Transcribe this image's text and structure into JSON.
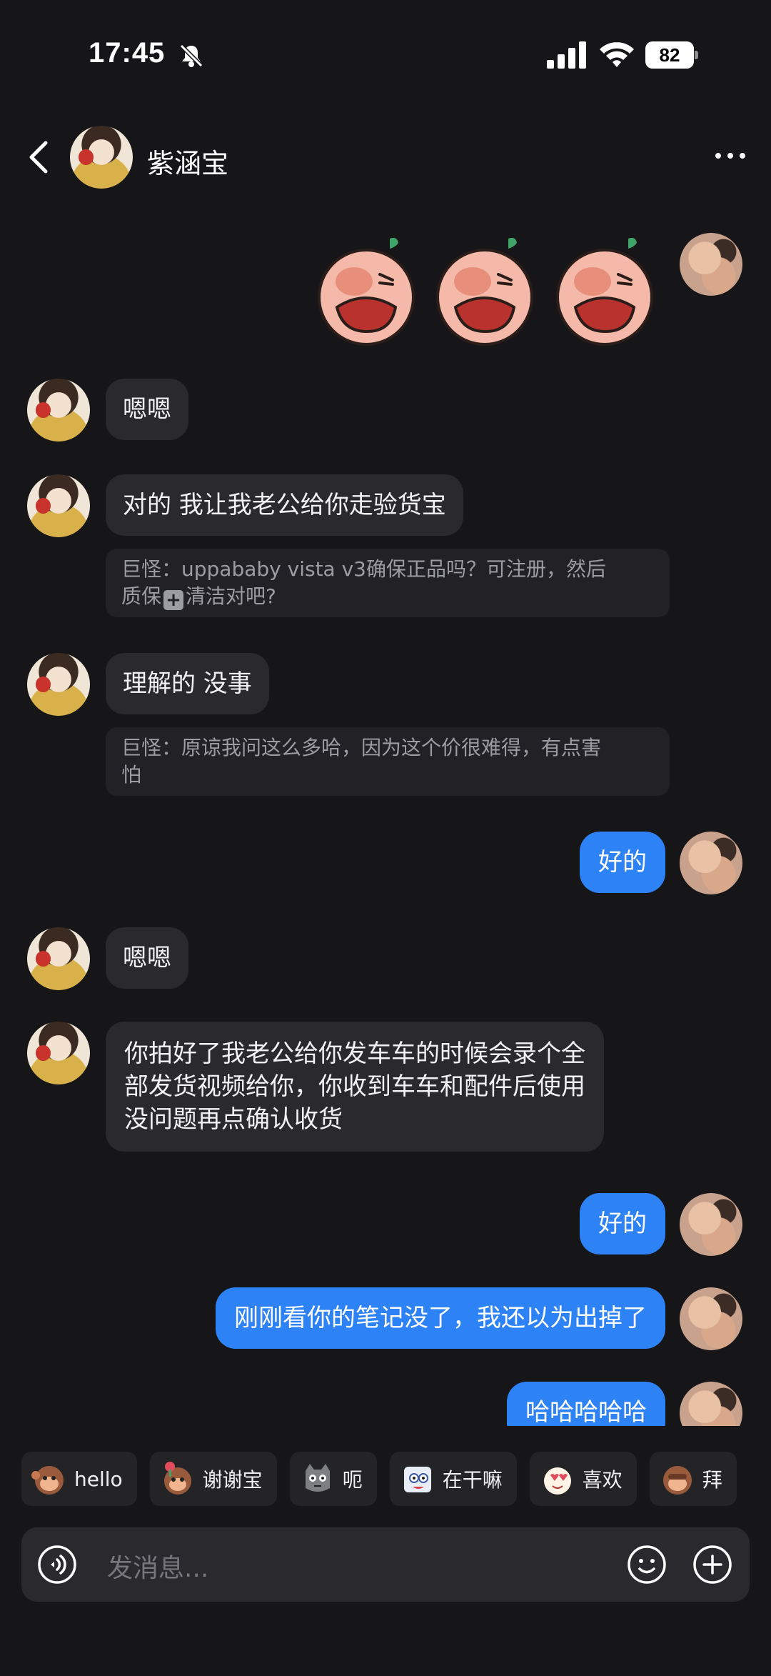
{
  "status_bar": {
    "time": "17:45",
    "battery": "82",
    "icons": [
      "bell-slash-icon",
      "signal-icon",
      "wifi-icon",
      "battery-icon"
    ]
  },
  "header": {
    "contact_name": "紫涵宝",
    "back_icon": "chevron-left-icon",
    "more_icon": "more-dots-icon"
  },
  "messages": {
    "m1_text": "嗯嗯",
    "m2_text": "对的 我让我老公给你走验货宝",
    "m2_quote": [
      "巨怪：uppababy vista v3确保正品吗？可注册，然后",
      "质保",
      "清洁对吧?"
    ],
    "m3_text": "理解的 没事",
    "m3_quote": [
      "巨怪：原谅我问这么多哈，因为这个价很难得，有点害",
      "怕"
    ],
    "m4_text": "好的",
    "m5_text": "嗯嗯",
    "m6_text": [
      "你拍好了我老公给你发车车的时候会录个全",
      "部发货视频给你，你收到车车和配件后使用",
      "没问题再点确认收货"
    ],
    "m7_text": "好的",
    "m8_text": "刚刚看你的笔记没了，我还以为出掉了",
    "m9_text": "哈哈哈哈哈"
  },
  "quick_replies": [
    {
      "label": "hello",
      "icon": "monkey-wave-icon"
    },
    {
      "label": "谢谢宝",
      "icon": "monkey-flower-icon"
    },
    {
      "label": "呃",
      "icon": "cat-speechless-icon"
    },
    {
      "label": "在干嘛",
      "icon": "peek-icon"
    },
    {
      "label": "喜欢",
      "icon": "love-icon"
    },
    {
      "label": "拜",
      "icon": "monkey-bye-icon"
    }
  ],
  "input": {
    "placeholder": "发消息...",
    "voice_icon": "voice-icon",
    "emoji_icon": "emoji-icon",
    "add_icon": "plus-icon"
  },
  "colors": {
    "background": "#161618",
    "incoming_bubble": "#2a2a2e",
    "outgoing_bubble": "#2d82f5",
    "quote_text": "#9c9ca3"
  }
}
